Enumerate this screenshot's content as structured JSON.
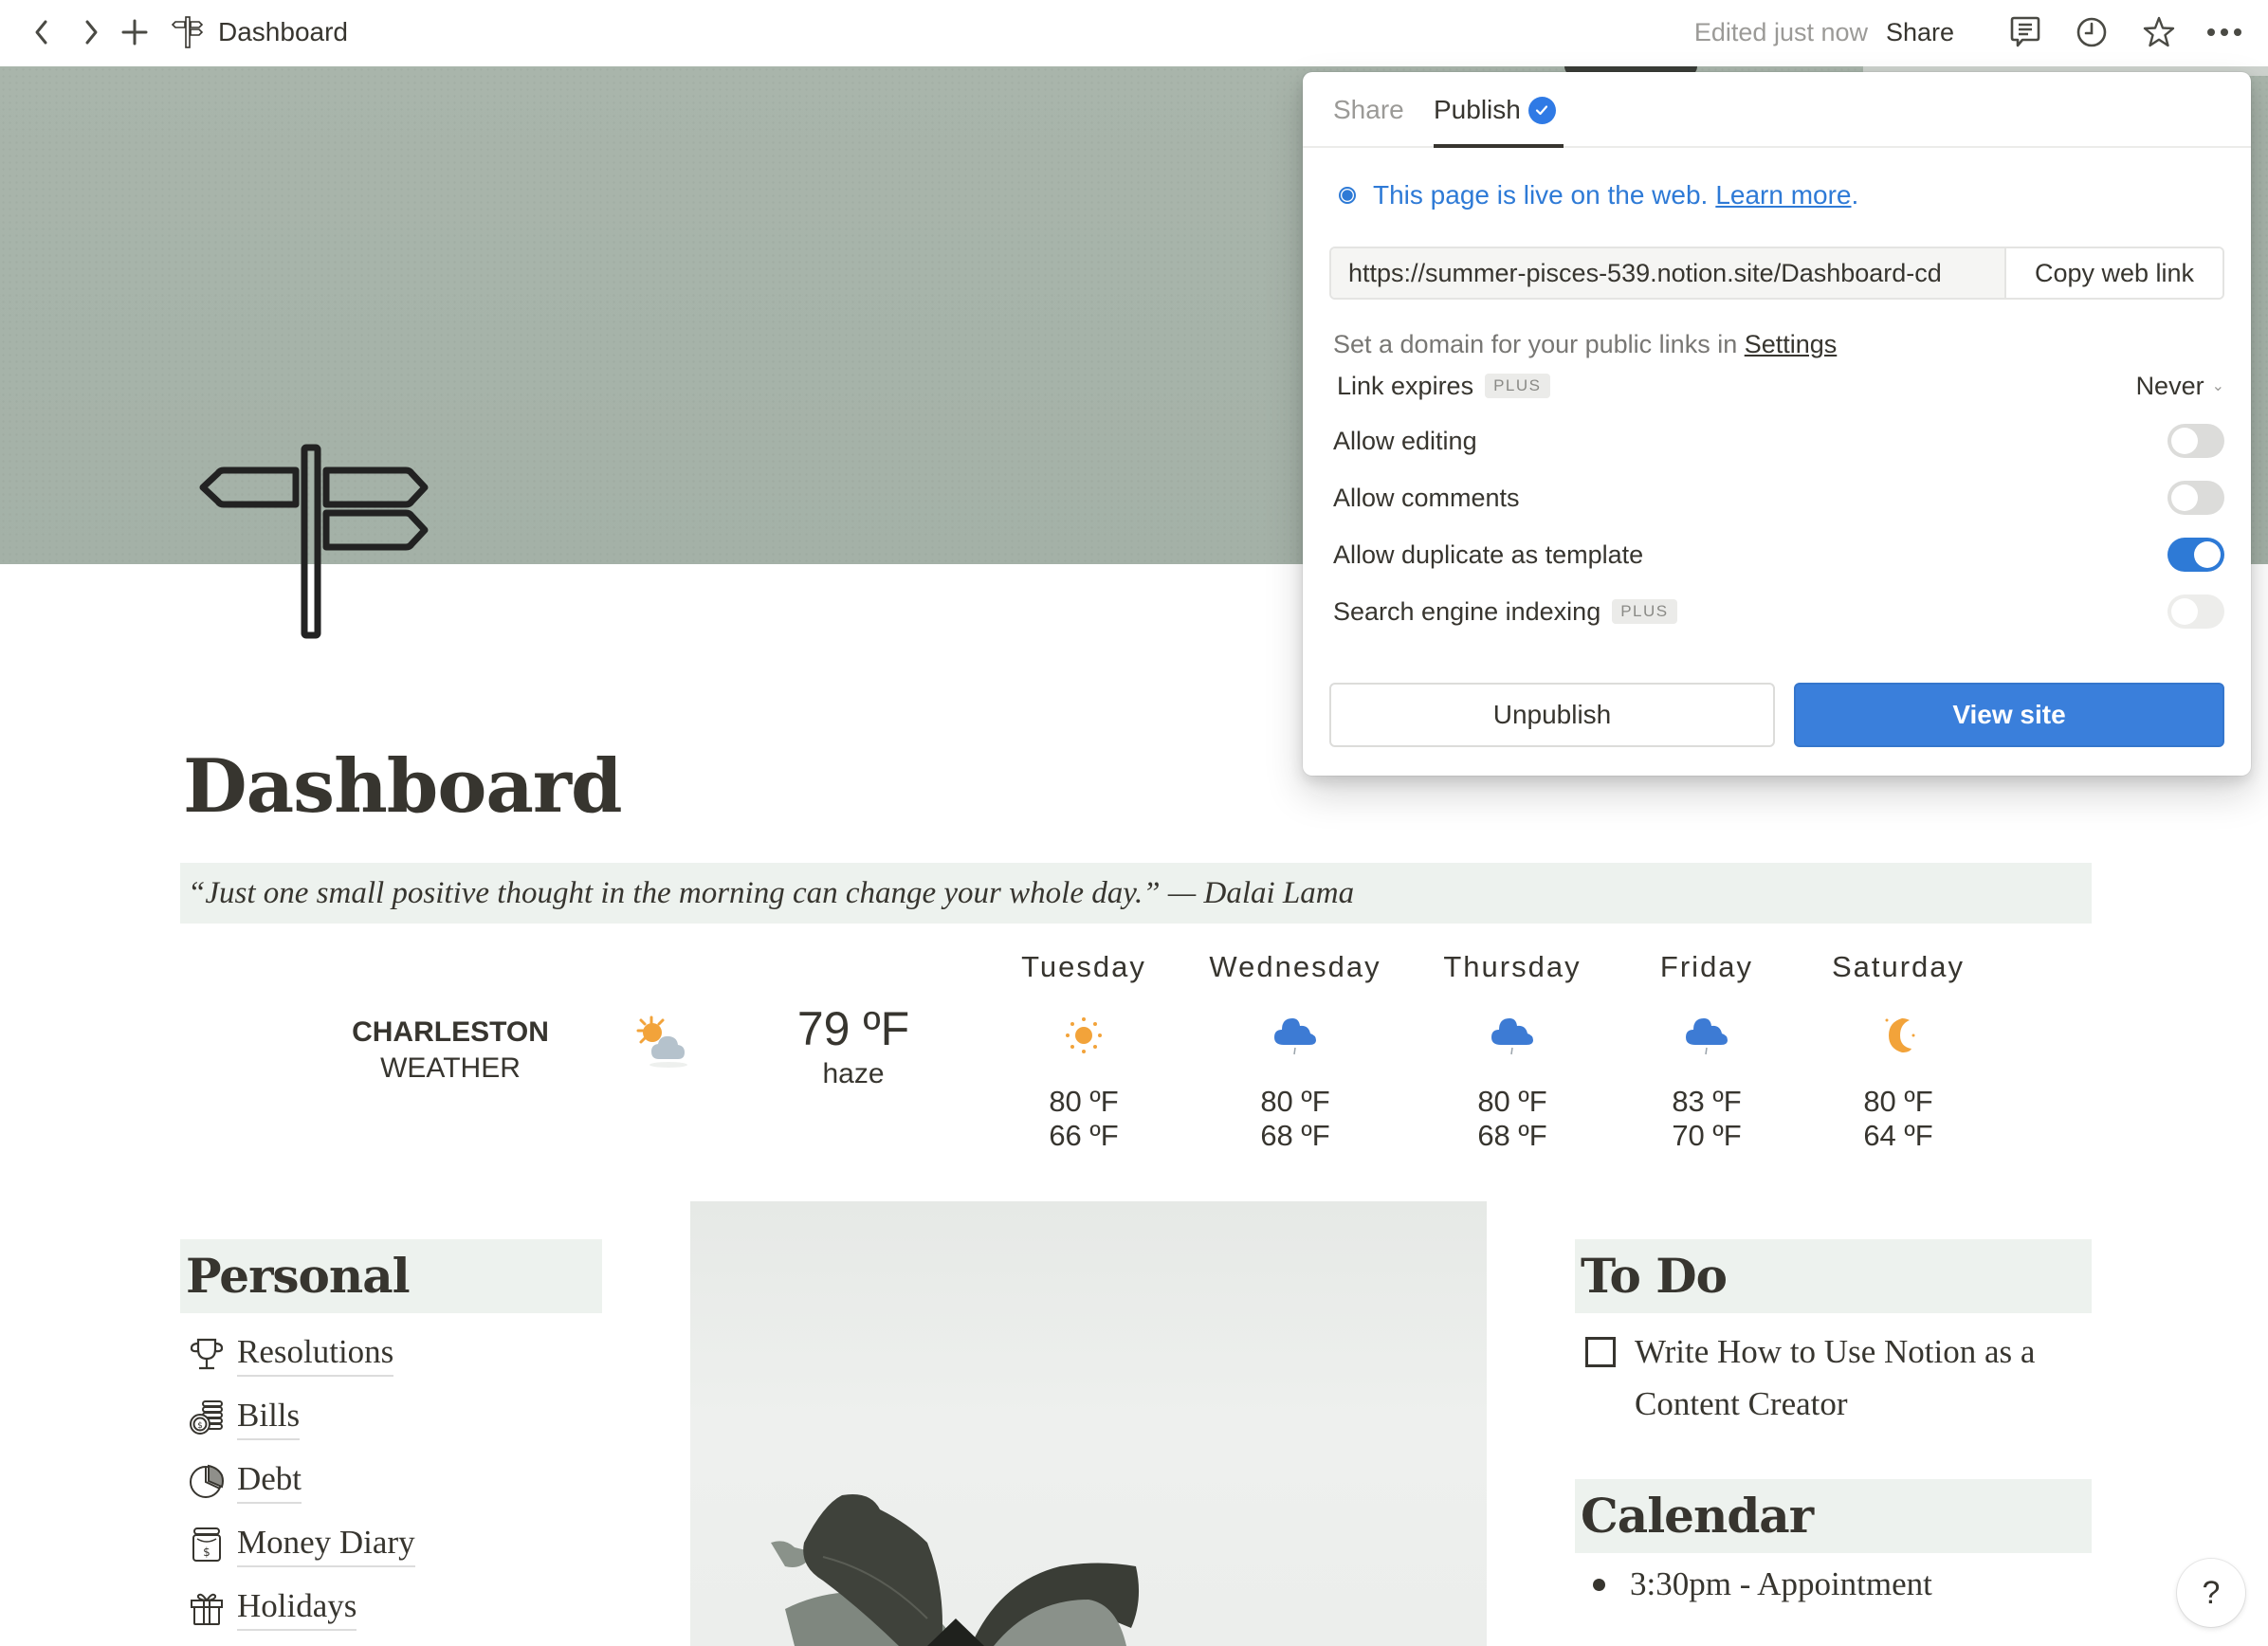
{
  "topbar": {
    "page_title": "Dashboard",
    "edited_status": "Edited just now",
    "share_label": "Share",
    "icons": [
      "chevron-left-icon",
      "chevron-right-icon",
      "plus-icon",
      "signpost-icon",
      "comment-icon",
      "clock-icon",
      "star-icon",
      "more-icon"
    ]
  },
  "page": {
    "title": "Dashboard",
    "quote": "“Just one small positive thought in the morning can change your whole day.” — Dalai Lama"
  },
  "weather": {
    "city": "CHARLESTON",
    "label": "WEATHER",
    "current_temp": "79 ºF",
    "current_condition": "haze",
    "current_icon": "sun-cloud-icon",
    "forecast": [
      {
        "day": "Tuesday",
        "icon": "sun-icon",
        "high": "80 ºF",
        "low": "66 ºF"
      },
      {
        "day": "Wednesday",
        "icon": "rain-cloud-icon",
        "high": "80 ºF",
        "low": "68 ºF"
      },
      {
        "day": "Thursday",
        "icon": "rain-cloud-icon",
        "high": "80 ºF",
        "low": "68 ºF"
      },
      {
        "day": "Friday",
        "icon": "rain-cloud-icon",
        "high": "83 ºF",
        "low": "70 ºF"
      },
      {
        "day": "Saturday",
        "icon": "moon-icon",
        "high": "80 ºF",
        "low": "64 ºF"
      }
    ]
  },
  "personal": {
    "heading": "Personal",
    "items": [
      {
        "label": "Resolutions",
        "icon": "trophy-icon"
      },
      {
        "label": "Bills",
        "icon": "coins-icon"
      },
      {
        "label": "Debt",
        "icon": "pie-chart-icon"
      },
      {
        "label": "Money Diary",
        "icon": "money-jar-icon"
      },
      {
        "label": "Holidays",
        "icon": "gift-icon"
      }
    ]
  },
  "todo": {
    "heading": "To Do",
    "items": [
      {
        "text": "Write How to Use Notion as a Content Creator",
        "checked": false
      }
    ]
  },
  "calendar": {
    "heading": "Calendar",
    "items": [
      "3:30pm - Appointment"
    ]
  },
  "help_label": "?",
  "publish_popup": {
    "tabs": [
      {
        "label": "Share",
        "active": false
      },
      {
        "label": "Publish",
        "active": true
      }
    ],
    "live_text": "This page is live on the web.",
    "learn_more": "Learn more",
    "url": "https://summer-pisces-539.notion.site/Dashboard-cd",
    "copy_label": "Copy web link",
    "domain_text": "Set a domain for your public links in ",
    "settings_link": "Settings",
    "link_expires_label": "Link expires",
    "plus_badge": "PLUS",
    "link_expires_value": "Never",
    "options": [
      {
        "label": "Allow editing",
        "on": false,
        "disabled": false
      },
      {
        "label": "Allow comments",
        "on": false,
        "disabled": false
      },
      {
        "label": "Allow duplicate as template",
        "on": true,
        "disabled": false
      },
      {
        "label": "Search engine indexing",
        "on": false,
        "disabled": true,
        "badge": "PLUS"
      }
    ],
    "unpublish_label": "Unpublish",
    "view_site_label": "View site",
    "accent_color": "#2e7ad6"
  }
}
